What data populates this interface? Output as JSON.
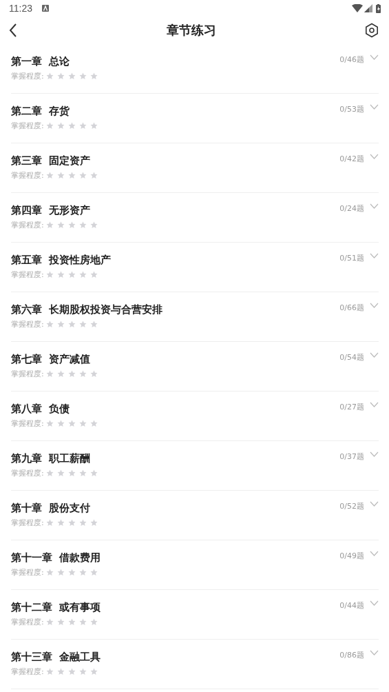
{
  "status_bar": {
    "time": "11:23"
  },
  "header": {
    "title": "章节练习"
  },
  "chapters": [
    {
      "title": "第一章  总论",
      "mastery_label": "掌握程度:",
      "stars": 0,
      "count": "0/46题",
      "expanded": false
    },
    {
      "title": "第二章  存货",
      "mastery_label": "掌握程度:",
      "stars": 0,
      "count": "0/53题",
      "expanded": false
    },
    {
      "title": "第三章  固定资产",
      "mastery_label": "掌握程度:",
      "stars": 0,
      "count": "0/42题",
      "expanded": false
    },
    {
      "title": "第四章  无形资产",
      "mastery_label": "掌握程度:",
      "stars": 0,
      "count": "0/24题",
      "expanded": false
    },
    {
      "title": "第五章  投资性房地产",
      "mastery_label": "掌握程度:",
      "stars": 0,
      "count": "0/51题",
      "expanded": false
    },
    {
      "title": "第六章  长期股权投资与合营安排",
      "mastery_label": "掌握程度:",
      "stars": 0,
      "count": "0/66题",
      "expanded": false
    },
    {
      "title": "第七章  资产减值",
      "mastery_label": "掌握程度:",
      "stars": 0,
      "count": "0/54题",
      "expanded": false
    },
    {
      "title": "第八章  负债",
      "mastery_label": "掌握程度:",
      "stars": 0,
      "count": "0/27题",
      "expanded": false
    },
    {
      "title": "第九章  职工薪酬",
      "mastery_label": "掌握程度:",
      "stars": 0,
      "count": "0/37题",
      "expanded": false
    },
    {
      "title": "第十章  股份支付",
      "mastery_label": "掌握程度:",
      "stars": 0,
      "count": "0/52题",
      "expanded": false
    },
    {
      "title": "第十一章  借款费用",
      "mastery_label": "掌握程度:",
      "stars": 0,
      "count": "0/49题",
      "expanded": false
    },
    {
      "title": "第十二章  或有事项",
      "mastery_label": "掌握程度:",
      "stars": 0,
      "count": "0/44题",
      "expanded": false
    },
    {
      "title": "第十三章  金融工具",
      "mastery_label": "掌握程度:",
      "stars": 0,
      "count": "0/86题",
      "expanded": false
    }
  ]
}
